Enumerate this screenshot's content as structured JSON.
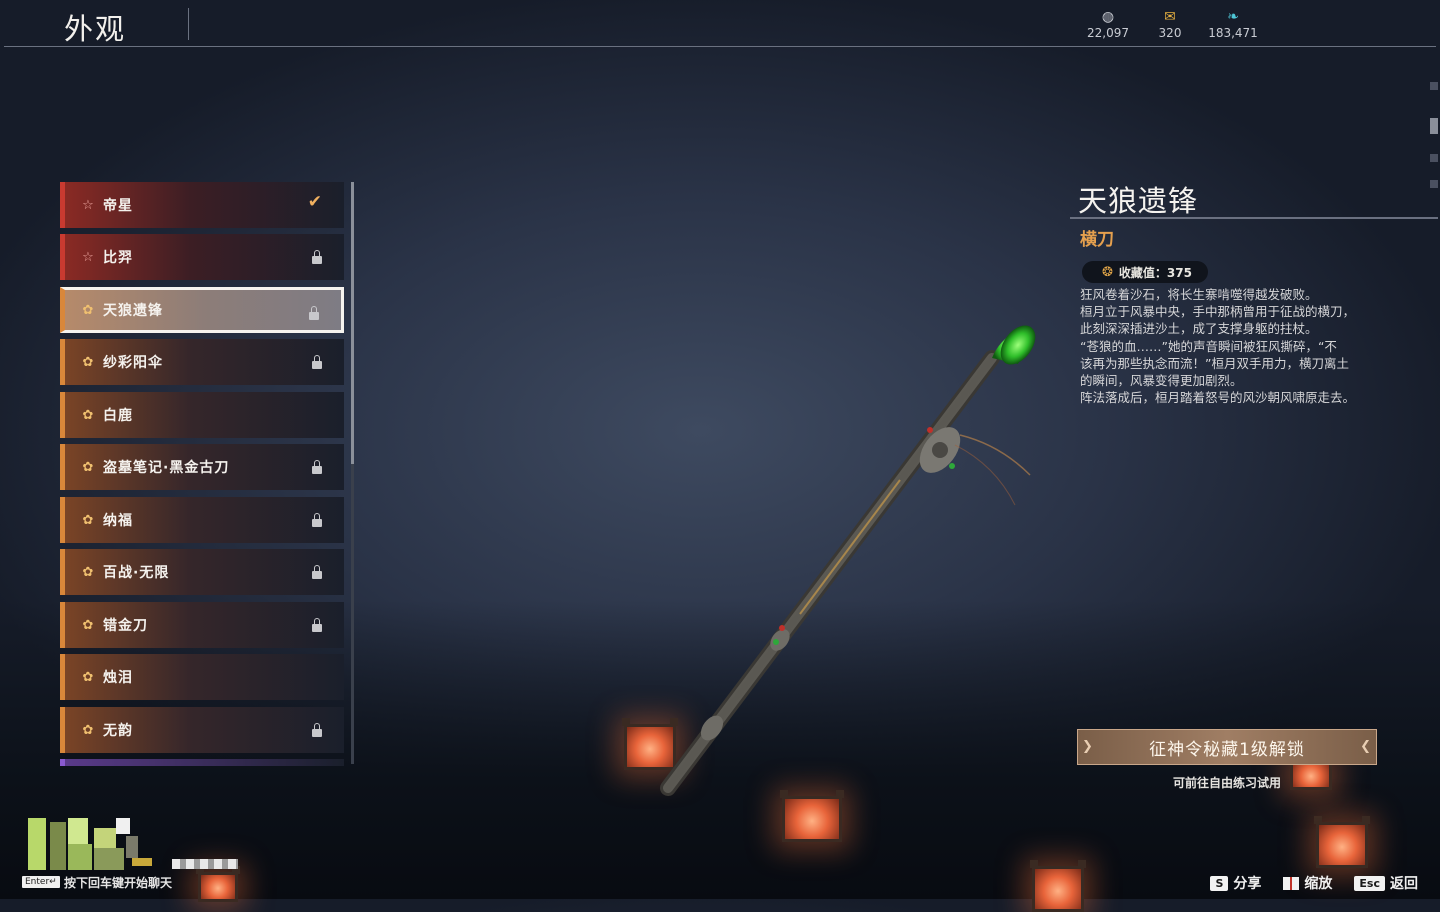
{
  "header": {
    "title": "外观",
    "currencies": [
      {
        "icon": "coin-icon",
        "value": "22,097"
      },
      {
        "icon": "ticket-icon",
        "value": "320"
      },
      {
        "icon": "feather-icon",
        "value": "183,471"
      }
    ]
  },
  "list": {
    "items": [
      {
        "label": "帝星",
        "icon": "star-icon",
        "status": "equipped"
      },
      {
        "label": "比羿",
        "icon": "star-icon",
        "status": "locked"
      },
      {
        "label": "天狼遗锋",
        "icon": "flower-icon",
        "status": "locked",
        "selected": true
      },
      {
        "label": "纱彩阳伞",
        "icon": "flower-icon",
        "status": "locked"
      },
      {
        "label": "白鹿",
        "icon": "flower-icon",
        "status": "none"
      },
      {
        "label": "盗墓笔记·黑金古刀",
        "icon": "flower-icon",
        "status": "locked"
      },
      {
        "label": "纳福",
        "icon": "flower-icon",
        "status": "locked"
      },
      {
        "label": "百战·无限",
        "icon": "flower-icon",
        "status": "locked"
      },
      {
        "label": "错金刀",
        "icon": "flower-icon",
        "status": "locked"
      },
      {
        "label": "烛泪",
        "icon": "flower-icon",
        "status": "none"
      },
      {
        "label": "无韵",
        "icon": "flower-icon",
        "status": "locked"
      }
    ]
  },
  "detail": {
    "name": "天狼遗锋",
    "type": "横刀",
    "collection_label": "收藏值：375",
    "description": [
      "狂风卷着沙石，将长生寨啃噬得越发破败。",
      "桓月立于风暴中央，手中那柄曾用于征战的横刀，",
      "此刻深深插进沙土，成了支撑身躯的拄杖。",
      "“苍狼的血……”她的声音瞬间被狂风撕碎，“不",
      "该再为那些执念而流！”桓月双手用力，横刀离土",
      "的瞬间，风暴变得更加剧烈。",
      "阵法落成后，桓月踏着怒号的风沙朝风啸原走去。"
    ],
    "unlock_button": "征神令秘藏1级解锁",
    "hint": "可前往自由练习试用"
  },
  "chat": {
    "enter_key": "Enter↵",
    "hint": "按下回车键开始聊天"
  },
  "shortcuts": [
    {
      "key": "S",
      "label": "分享"
    },
    {
      "key": "book",
      "label": "缩放"
    },
    {
      "key": "Esc",
      "label": "返回"
    }
  ],
  "colors": {
    "accent_orange": "#e5a04e",
    "red_rarity": "#c93a30",
    "orange_rarity": "#d9873a"
  }
}
